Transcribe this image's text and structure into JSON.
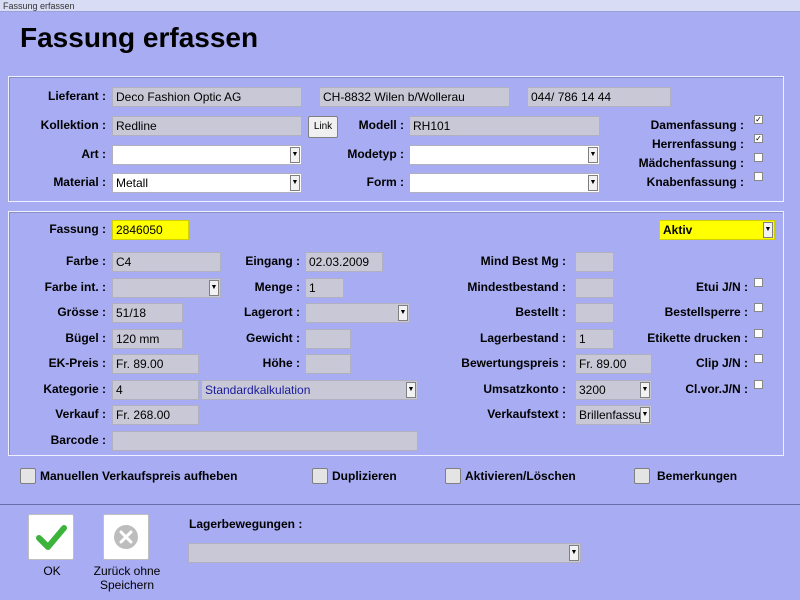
{
  "window_title": "Fassung erfassen",
  "page_title": "Fassung erfassen",
  "supplier": {
    "lieferant_label": "Lieferant :",
    "lieferant_name": "Deco Fashion Optic AG",
    "lieferant_location": "CH-8832 Wilen b/Wollerau",
    "lieferant_phone": "044/ 786 14 44",
    "kollektion_label": "Kollektion :",
    "kollektion_value": "Redline",
    "link_label": "Link",
    "modell_label": "Modell :",
    "modell_value": "RH101",
    "art_label": "Art :",
    "art_value": "",
    "modetyp_label": "Modetyp :",
    "modetyp_value": "",
    "material_label": "Material :",
    "material_value": "Metall",
    "form_label": "Form :",
    "form_value": "",
    "damen_label": "Damenfassung :",
    "damen_checked": true,
    "herren_label": "Herrenfassung :",
    "herren_checked": true,
    "maedchen_label": "Mädchenfassung :",
    "maedchen_checked": false,
    "knaben_label": "Knabenfassung :",
    "knaben_checked": false
  },
  "detail": {
    "fassung_label": "Fassung :",
    "fassung_value": "2846050",
    "status_value": "Aktiv",
    "farbe_label": "Farbe :",
    "farbe_value": "C4",
    "eingang_label": "Eingang :",
    "eingang_value": "02.03.2009",
    "mind_best_label": "Mind Best Mg :",
    "mind_best_value": "",
    "farbe_int_label": "Farbe int. :",
    "farbe_int_value": "",
    "menge_label": "Menge :",
    "menge_value": "1",
    "mindestbestand_label": "Mindestbestand :",
    "mindestbestand_value": "",
    "etui_label": "Etui J/N :",
    "groesse_label": "Grösse :",
    "groesse_value": "51/18",
    "lagerort_label": "Lagerort :",
    "lagerort_value": "",
    "bestellt_label": "Bestellt :",
    "bestellt_value": "",
    "bestellsperre_label": "Bestellsperre :",
    "buegel_label": "Bügel :",
    "buegel_value": "120 mm",
    "gewicht_label": "Gewicht :",
    "gewicht_value": "",
    "lagerbestand_label": "Lagerbestand :",
    "lagerbestand_value": "1",
    "etikette_label": "Etikette drucken :",
    "ek_preis_label": "EK-Preis :",
    "ek_preis_value": "Fr. 89.00",
    "hoehe_label": "Höhe :",
    "hoehe_value": "",
    "bewertungspreis_label": "Bewertungspreis :",
    "bewertungspreis_value": "Fr. 89.00",
    "clip_label": "Clip J/N :",
    "kategorie_label": "Kategorie :",
    "kategorie_value": "4",
    "kalkulation_value": "Standardkalkulation",
    "umsatzkonto_label": "Umsatzkonto :",
    "umsatzkonto_value": "3200",
    "clvor_label": "Cl.vor.J/N :",
    "verkauf_label": "Verkauf :",
    "verkauf_value": "Fr. 268.00",
    "verkaufstext_label": "Verkaufstext :",
    "verkaufstext_value": "Brillenfassu",
    "barcode_label": "Barcode :",
    "barcode_value": ""
  },
  "options": {
    "manuell_label": "Manuellen Verkaufspreis aufheben",
    "duplizieren_label": "Duplizieren",
    "aktivieren_label": "Aktivieren/Löschen",
    "bemerkungen_label": "Bemerkungen"
  },
  "footer": {
    "ok_label": "OK",
    "cancel_label_line1": "Zurück ohne",
    "cancel_label_line2": "Speichern",
    "lagerbewegungen_label": "Lagerbewegungen :",
    "lagerbewegungen_value": ""
  },
  "colors": {
    "background": "#a8acf2",
    "highlight": "#ffff00",
    "ok_green": "#3cb43c"
  },
  "icons": {
    "ok": "checkmark-icon",
    "cancel": "x-circle-icon",
    "dropdown": "chevron-down-icon"
  }
}
